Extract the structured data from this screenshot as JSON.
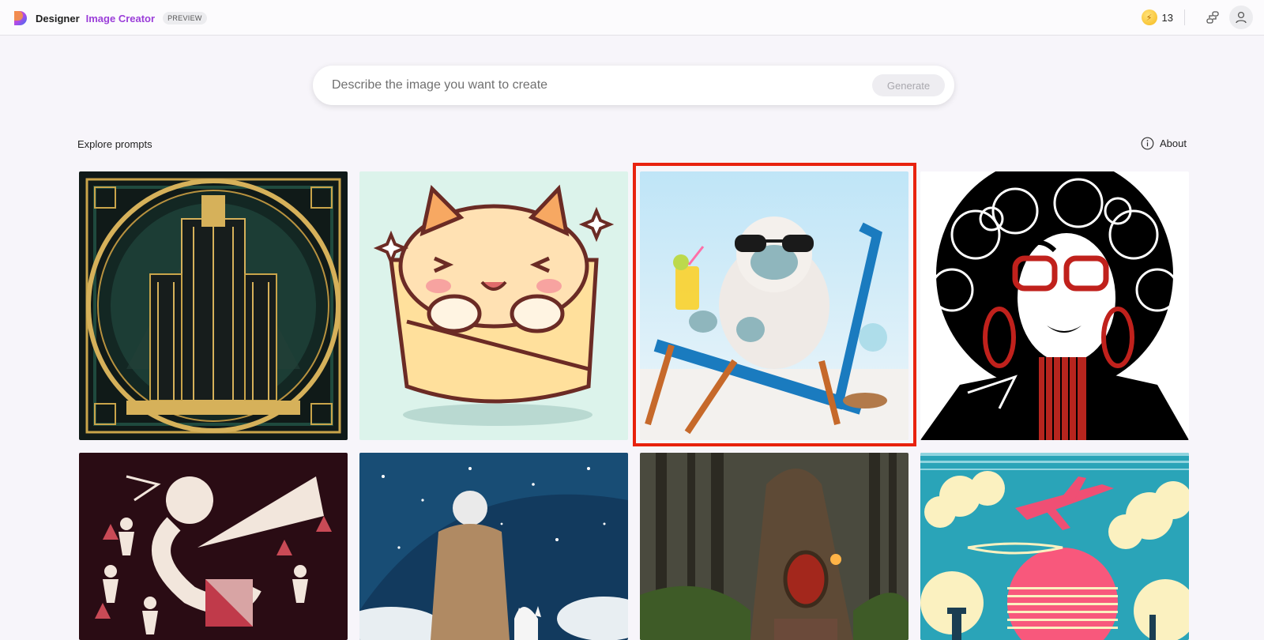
{
  "header": {
    "brand_name": "Designer",
    "product_name": "Image Creator",
    "badge": "PREVIEW",
    "coins": "13",
    "icons": {
      "logo": "designer-logo",
      "coin": "boost-coin-icon",
      "share": "connections-icon",
      "account": "account-icon"
    }
  },
  "search": {
    "placeholder": "Describe the image you want to create",
    "value": "",
    "generate_label": "Generate"
  },
  "explore": {
    "title": "Explore prompts",
    "about_label": "About"
  },
  "gallery": [
    {
      "subject": "art-deco-building"
    },
    {
      "subject": "cat-in-burrito"
    },
    {
      "subject": "yeti-on-beach-chair",
      "highlighted": true
    },
    {
      "subject": "woman-with-red-glasses"
    },
    {
      "subject": "trumpet-figures-pattern"
    },
    {
      "subject": "old-man-and-cat-starry-sky"
    },
    {
      "subject": "tree-house-forest"
    },
    {
      "subject": "retro-airplane-clouds"
    }
  ],
  "colors": {
    "highlight": "#e8220f",
    "accent": "#9b3ed9",
    "coin": "#f6b91c"
  }
}
